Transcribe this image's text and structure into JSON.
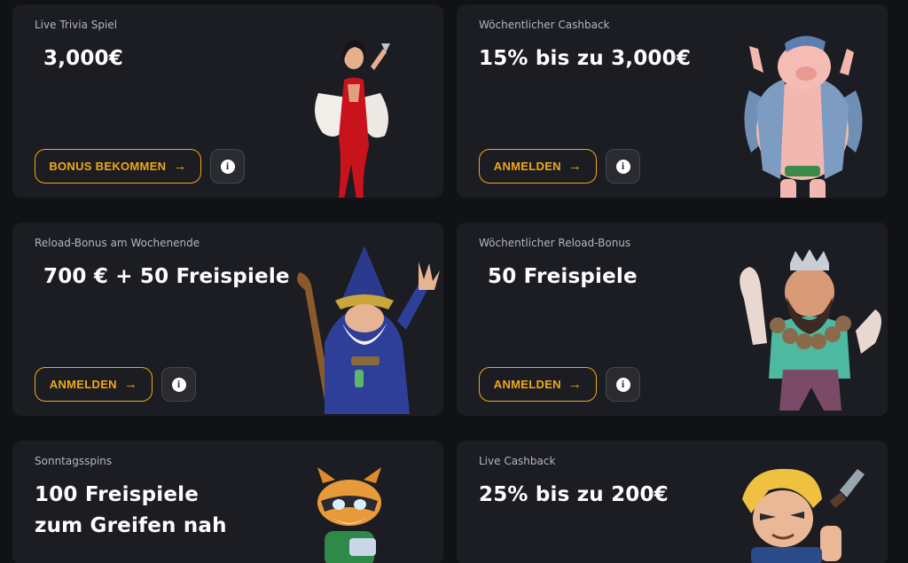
{
  "promos": [
    {
      "label": "Live Trivia Spiel",
      "title": "3,000€",
      "button": "BONUS BEKOMMEN",
      "button_arrow": "→",
      "info": "i",
      "character": "woman-in-red-dress-icon"
    },
    {
      "label": "Wöchentlicher Cashback",
      "title": "15% bis zu 3,000€",
      "button": "ANMELDEN",
      "button_arrow": "→",
      "info": "i",
      "character": "pig-character-icon"
    },
    {
      "label": "Reload-Bonus am Wochenende",
      "title": "700 € + 50 Freispiele",
      "button": "ANMELDEN",
      "button_arrow": "→",
      "info": "i",
      "character": "wizard-character-icon"
    },
    {
      "label": "Wöchentlicher Reload-Bonus",
      "title": "50 Freispiele",
      "button": "ANMELDEN",
      "button_arrow": "→",
      "info": "i",
      "character": "bearded-warrior-icon"
    },
    {
      "label": "Sonntagsspins",
      "title_line1": "100 Freispiele",
      "title_line2": "zum Greifen nah",
      "character": "raccoon-character-icon"
    },
    {
      "label": "Live Cashback",
      "title": "25% bis zu 200€",
      "character": "blonde-hero-icon"
    }
  ],
  "colors": {
    "background": "#111215",
    "card": "#1c1d22",
    "accent": "#f0a818",
    "label": "#b4b6bd"
  }
}
